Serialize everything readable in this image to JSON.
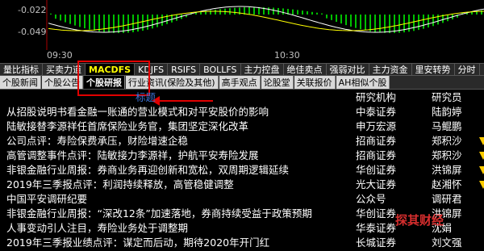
{
  "chart": {
    "y_labels": [
      "-0.022",
      "-0.049"
    ],
    "x_labels": [
      "09:30",
      "10:30"
    ]
  },
  "tabs_row1": [
    {
      "label": "量比指标",
      "active": false
    },
    {
      "label": "买卖力道",
      "active": false
    },
    {
      "label": "MACDFS",
      "active": true
    },
    {
      "label": "KDJFS",
      "active": false
    },
    {
      "label": "RSIFS",
      "active": false
    },
    {
      "label": "BOLLFS",
      "active": false
    },
    {
      "label": "主力控盘",
      "active": false
    },
    {
      "label": "绝佳卖点",
      "active": false
    },
    {
      "label": "强弱对比",
      "active": false
    },
    {
      "label": "主力资金",
      "active": false
    },
    {
      "label": "里安转势",
      "active": false
    },
    {
      "label": "分时",
      "active": false
    }
  ],
  "tabs_row2": [
    {
      "label": "个股新闻",
      "active": false
    },
    {
      "label": "个股公告",
      "active": false
    },
    {
      "label": "个股研报",
      "active": true
    },
    {
      "label": "行业资讯(保险及其他)",
      "active": false
    },
    {
      "label": "高手观点",
      "active": false
    },
    {
      "label": "论股堂",
      "active": false
    },
    {
      "label": "关联报价",
      "active": false
    },
    {
      "label": "AH相似个股",
      "active": false
    }
  ],
  "table": {
    "header": {
      "title": "标题",
      "org": "研究机构",
      "analyst": "研究员"
    },
    "rows": [
      {
        "title": "从招股说明书看金融一账通的营业模式和对平安股价的影响",
        "org": "中泰证券",
        "analyst": "陆韵婷",
        "flag": false
      },
      {
        "title": "陆敏接替李源祥任首席保险业务官，集团坚定深化改革",
        "org": "申万宏源",
        "analyst": "马鲲鹏",
        "flag": false
      },
      {
        "title": "公司点评：寿险保费承压，财险增速企稳",
        "org": "招商证券",
        "analyst": "郑积沙",
        "flag": true
      },
      {
        "title": "高管调整事件点评：陆敏接力李源祥，护航平安寿险发展",
        "org": "招商证券",
        "analyst": "郑积沙",
        "flag": true
      },
      {
        "title": "非银金融行业周报：券商业务再迎创新和宽松，双周期逻辑延续",
        "org": "华创证券",
        "analyst": "洪锦屏",
        "flag": true
      },
      {
        "title": "2019年三季报点评：利润持续释放，高管稳健调整",
        "org": "光大证券",
        "analyst": "赵湘怀",
        "flag": true
      },
      {
        "title": "中国平安调研纪要",
        "org": "公众号",
        "analyst": "调研君",
        "flag": false
      },
      {
        "title": "非银金融行业周报：“深改12条”加速落地，券商持续受益于政策预期",
        "org": "华创证券",
        "analyst": "洪锦屏",
        "flag": false
      },
      {
        "title": "人事变动引人注目，寿险业务处于调整期",
        "org": "华泰证券",
        "analyst": "沈娟",
        "flag": false
      },
      {
        "title": "2019年三季报业绩点评：谋定而后动，期待2020年开门红",
        "org": "长城证券",
        "analyst": "刘文强",
        "flag": false
      }
    ]
  },
  "watermark": "探其财经",
  "colors": {
    "highlight_box": "#e00000",
    "arrow": "#e00000",
    "active_tab_text": "#ffff00",
    "bar_positive": "#00c000",
    "line_white": "#ffffff",
    "line_yellow": "#ffff00"
  }
}
